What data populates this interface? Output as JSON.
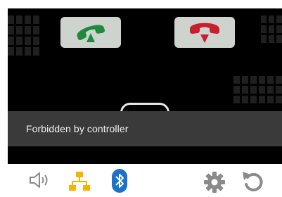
{
  "toast": {
    "message": "Forbidden by controller"
  },
  "call_controls": {
    "answer_icon": "phone-answer-icon",
    "hangup_icon": "phone-hangup-icon",
    "answer_color": "#1f8a3a",
    "hangup_color": "#c81e2e"
  },
  "bottom_bar": {
    "icons": [
      "speaker-icon",
      "network-icon",
      "bluetooth-icon",
      "settings-gear-icon",
      "reset-icon"
    ],
    "network_color": "#f5b400",
    "bluetooth_color": "#1a73c9"
  }
}
